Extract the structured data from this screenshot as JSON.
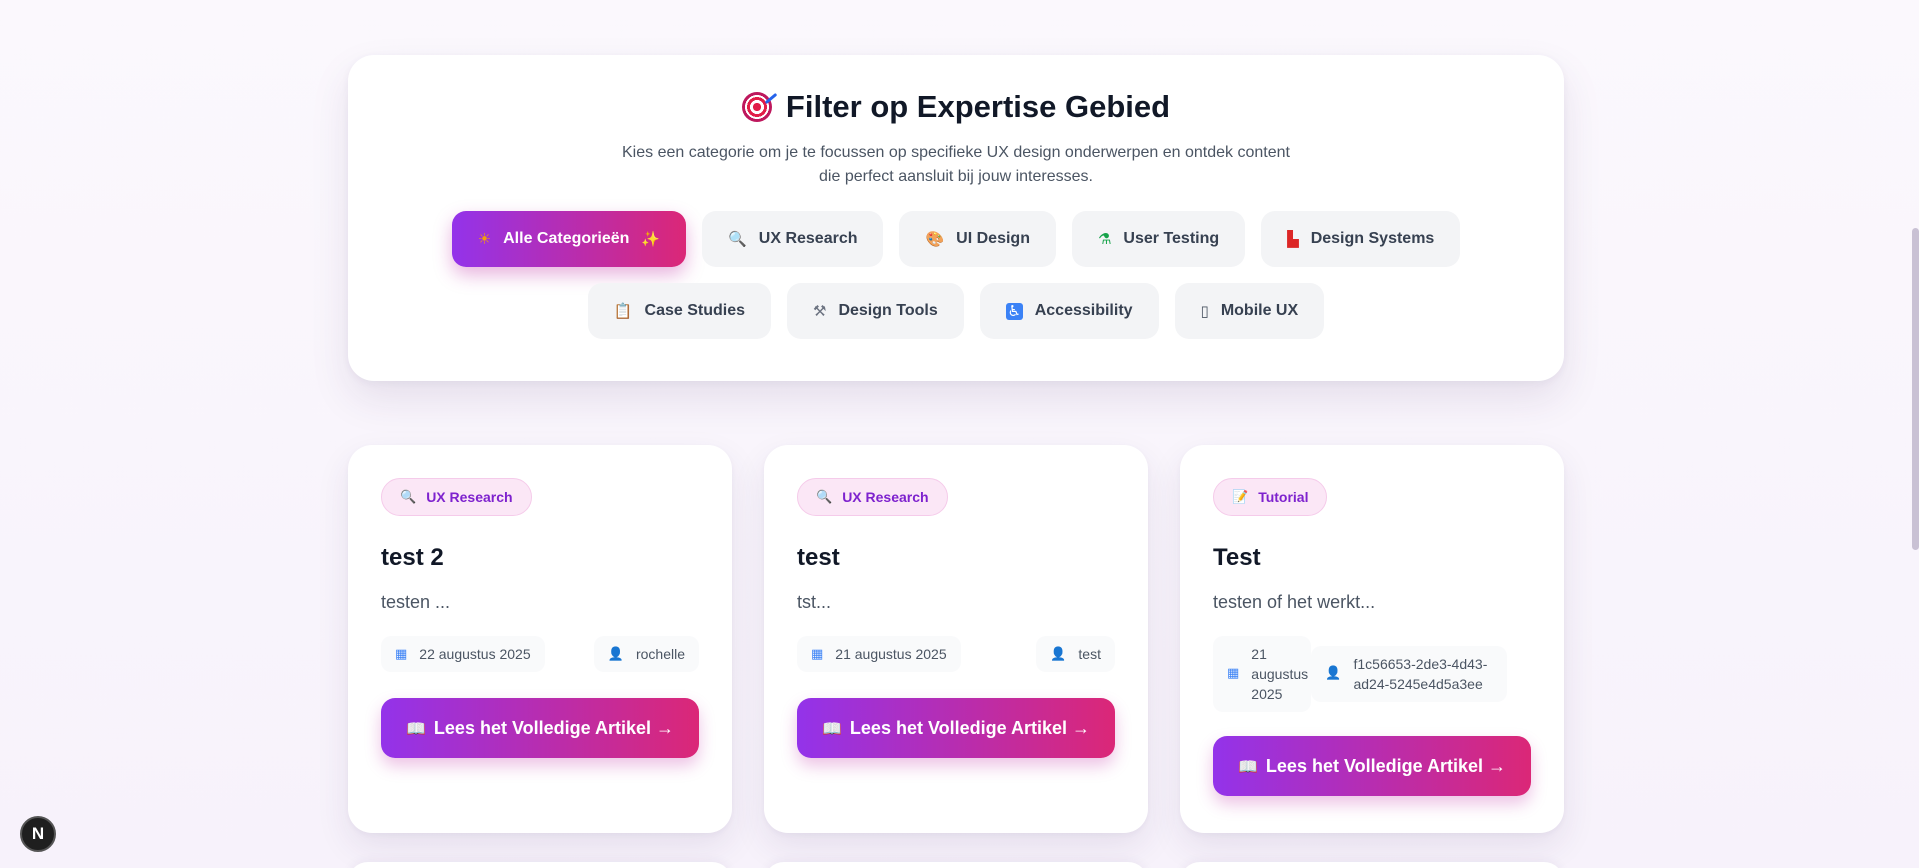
{
  "filter": {
    "title": "Filter op Expertise Gebied",
    "description": "Kies een categorie om je te focussen op specifieke UX design onderwerpen en ontdek content die perfect aansluit bij jouw interesses.",
    "categories_row1": [
      {
        "label": "Alle Categorieën",
        "icon": "sun-icon",
        "active": true
      },
      {
        "label": "UX Research",
        "icon": "magnifier-icon",
        "active": false
      },
      {
        "label": "UI Design",
        "icon": "palette-icon",
        "active": false
      },
      {
        "label": "User Testing",
        "icon": "flask-icon",
        "active": false
      },
      {
        "label": "Design Systems",
        "icon": "chart-icon",
        "active": false
      }
    ],
    "categories_row2": [
      {
        "label": "Case Studies",
        "icon": "clipboard-icon",
        "active": false
      },
      {
        "label": "Design Tools",
        "icon": "tools-icon",
        "active": false
      },
      {
        "label": "Accessibility",
        "icon": "accessibility-icon",
        "active": false
      },
      {
        "label": "Mobile UX",
        "icon": "phone-icon",
        "active": false
      }
    ]
  },
  "articles": [
    {
      "category": "UX Research",
      "category_icon": "magnifier-icon",
      "title": "test 2",
      "excerpt": "testen ...",
      "date": "22 augustus 2025",
      "author": "rochelle",
      "button": "Lees het Volledige Artikel →"
    },
    {
      "category": "UX Research",
      "category_icon": "magnifier-icon",
      "title": "test",
      "excerpt": "tst...",
      "date": "21 augustus 2025",
      "author": "test",
      "button": "Lees het Volledige Artikel →"
    },
    {
      "category": "Tutorial",
      "category_icon": "notebook-icon",
      "title": "Test",
      "excerpt": "testen of het werkt...",
      "date": "21 augustus 2025",
      "author": "f1c56653-2de3-4d43-ad24-5245e4d5a3ee",
      "button": "Lees het Volledige Artikel →"
    }
  ],
  "dev_badge": "N",
  "colors": {
    "accent_start": "#9333ea",
    "accent_end": "#db2777",
    "badge_bg": "#fbe7f6",
    "badge_text": "#7e22ce"
  }
}
